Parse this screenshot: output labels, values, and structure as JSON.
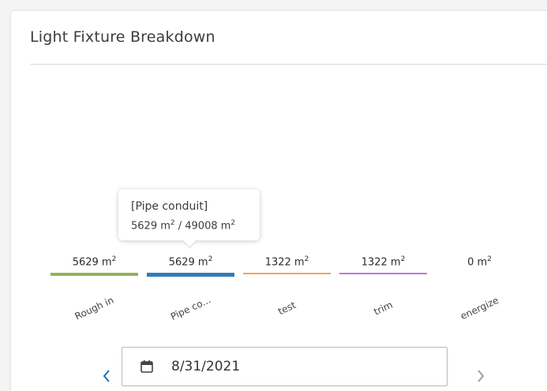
{
  "card": {
    "title": "Light Fixture Breakdown"
  },
  "tooltip": {
    "title": "[Pipe conduit]",
    "value_num": "5629 m",
    "value_sup": "2",
    "value_sep": " / 49008 m",
    "value_sup2": "2"
  },
  "stages": [
    {
      "value": "5629 m",
      "unit_sup": "2",
      "label": "Rough in",
      "color": "#94b359",
      "bar_thickness": 4
    },
    {
      "value": "5629 m",
      "unit_sup": "2",
      "label": "Pipe co...",
      "color": "#2f7db8",
      "bar_thickness": 5
    },
    {
      "value": "1322 m",
      "unit_sup": "2",
      "label": "test",
      "color": "#f0a35a",
      "bar_thickness": 2
    },
    {
      "value": "1322 m",
      "unit_sup": "2",
      "label": "trim",
      "color": "#c173e0",
      "bar_thickness": 2
    },
    {
      "value": "0 m",
      "unit_sup": "2",
      "label": "energize",
      "color": "#ffffff",
      "bar_thickness": 0
    }
  ],
  "date_picker": {
    "value": "8/31/2021",
    "prev_icon": "chevron-left-icon",
    "next_icon": "chevron-right-icon",
    "calendar_icon": "calendar-icon"
  }
}
